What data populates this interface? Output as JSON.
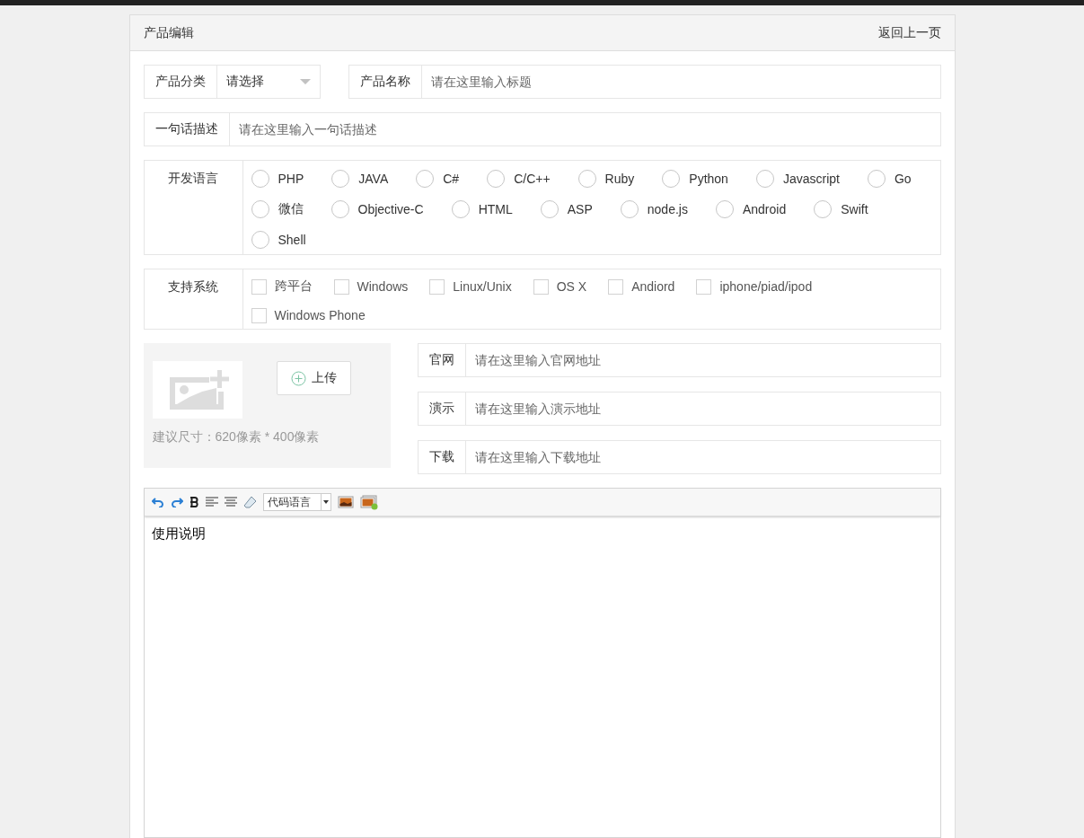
{
  "header": {
    "title": "产品编辑",
    "back_link": "返回上一页"
  },
  "category": {
    "label": "产品分类",
    "value": "请选择"
  },
  "name": {
    "label": "产品名称",
    "placeholder": "请在这里输入标题"
  },
  "summary": {
    "label": "一句话描述",
    "placeholder": "请在这里输入一句话描述"
  },
  "languages": {
    "label": "开发语言",
    "options": [
      {
        "label": "PHP",
        "selected": false
      },
      {
        "label": "JAVA",
        "selected": false
      },
      {
        "label": "C#",
        "selected": false
      },
      {
        "label": "C/C++",
        "selected": false
      },
      {
        "label": "Ruby",
        "selected": false
      },
      {
        "label": "Python",
        "selected": false
      },
      {
        "label": "Javascript",
        "selected": false
      },
      {
        "label": "Go",
        "selected": false
      },
      {
        "label": "微信",
        "selected": false
      },
      {
        "label": "Objective-C",
        "selected": false
      },
      {
        "label": "HTML",
        "selected": false
      },
      {
        "label": "ASP",
        "selected": false
      },
      {
        "label": "node.js",
        "selected": false
      },
      {
        "label": "Android",
        "selected": false
      },
      {
        "label": "Swift",
        "selected": false
      },
      {
        "label": "Shell",
        "selected": false
      }
    ]
  },
  "systems": {
    "label": "支持系统",
    "options": [
      {
        "label": "跨平台",
        "checked": false
      },
      {
        "label": "Windows",
        "checked": false
      },
      {
        "label": "Linux/Unix",
        "checked": false
      },
      {
        "label": "OS X",
        "checked": false
      },
      {
        "label": "Andiord",
        "checked": false
      },
      {
        "label": "iphone/piad/ipod",
        "checked": false
      },
      {
        "label": "Windows Phone",
        "checked": false
      }
    ]
  },
  "upload": {
    "button": "上传",
    "hint": "建议尺寸：620像素 * 400像素"
  },
  "links": [
    {
      "label": "官网",
      "placeholder": "请在这里输入官网地址"
    },
    {
      "label": "演示",
      "placeholder": "请在这里输入演示地址"
    },
    {
      "label": "下载",
      "placeholder": "请在这里输入下载地址"
    }
  ],
  "editor": {
    "code_language": "代码语言",
    "content": "使用说明"
  }
}
